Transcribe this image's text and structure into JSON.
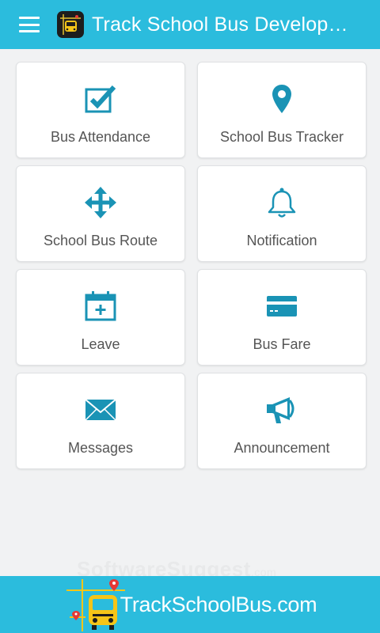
{
  "header": {
    "title": "Track School Bus Develop…",
    "menu_icon": "hamburger-icon",
    "logo_icon": "bus-logo-icon"
  },
  "menu": {
    "items": [
      {
        "label": "Bus Attendance",
        "icon": "checkbox-icon"
      },
      {
        "label": "School Bus Tracker",
        "icon": "map-pin-icon"
      },
      {
        "label": "School Bus Route",
        "icon": "move-arrows-icon"
      },
      {
        "label": "Notification",
        "icon": "bell-icon"
      },
      {
        "label": "Leave",
        "icon": "calendar-plus-icon"
      },
      {
        "label": "Bus Fare",
        "icon": "credit-card-icon"
      },
      {
        "label": "Messages",
        "icon": "envelope-icon"
      },
      {
        "label": "Announcement",
        "icon": "megaphone-icon"
      }
    ]
  },
  "watermark": {
    "text": "SoftwareSuggest",
    "suffix": ".com"
  },
  "footer": {
    "brand": "TrackSchoolBus.com"
  },
  "colors": {
    "primary": "#2bbcdd",
    "icon": "#1a93b5",
    "background": "#f1f2f3"
  }
}
